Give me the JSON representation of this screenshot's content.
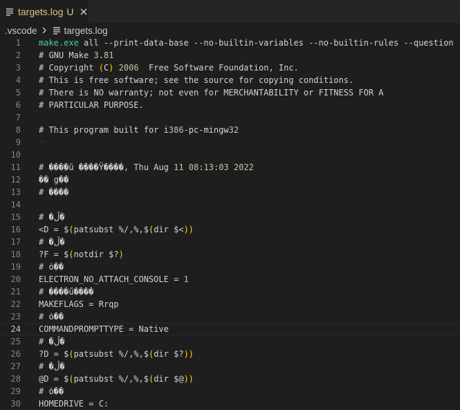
{
  "tab": {
    "file_name": "targets.log",
    "status": "U",
    "icon": "lines-file-icon",
    "close_icon": "close-icon"
  },
  "breadcrumb": {
    "folder": ".vscode",
    "file": "targets.log"
  },
  "editor": {
    "current_line": 24,
    "lines": [
      {
        "n": "1",
        "text": "make.exe all --print-data-base --no-builtin-variables --no-builtin-rules --question"
      },
      {
        "n": "2",
        "text": "# GNU Make 3.81"
      },
      {
        "n": "3",
        "text": "# Copyright (C) 2006  Free Software Foundation, Inc."
      },
      {
        "n": "4",
        "text": "# This is free software; see the source for copying conditions."
      },
      {
        "n": "5",
        "text": "# There is NO warranty; not even for MERCHANTABILITY or FITNESS FOR A"
      },
      {
        "n": "6",
        "text": "# PARTICULAR PURPOSE."
      },
      {
        "n": "7",
        "text": ""
      },
      {
        "n": "8",
        "text": "# This program built for i386-pc-mingw32"
      },
      {
        "n": "9",
        "text": ""
      },
      {
        "n": "10",
        "text": ""
      },
      {
        "n": "11",
        "text": "# ����ũ ����Ÿ����, Thu Aug 11 08:13:03 2022"
      },
      {
        "n": "12",
        "text": "�� g��"
      },
      {
        "n": "13",
        "text": "# ����"
      },
      {
        "n": "14",
        "text": ""
      },
      {
        "n": "15",
        "text": "# �ڵ�"
      },
      {
        "n": "16",
        "text": "<D = $(patsubst %/,%,$(dir $<))"
      },
      {
        "n": "17",
        "text": "# �ڵ�"
      },
      {
        "n": "18",
        "text": "?F = $(notdir $?)"
      },
      {
        "n": "19",
        "text": "# ȯ��"
      },
      {
        "n": "20",
        "text": "ELECTRON_NO_ATTACH_CONSOLE = 1"
      },
      {
        "n": "21",
        "text": "# ����ű����"
      },
      {
        "n": "22",
        "text": "MAKEFLAGS = Rrqp"
      },
      {
        "n": "23",
        "text": "# ȯ��"
      },
      {
        "n": "24",
        "text": "COMMANDPROMPTTYPE = Native"
      },
      {
        "n": "25",
        "text": "# �ڵ�"
      },
      {
        "n": "26",
        "text": "?D = $(patsubst %/,%,$(dir $?))"
      },
      {
        "n": "27",
        "text": "# �ڵ�"
      },
      {
        "n": "28",
        "text": "@D = $(patsubst %/,%,$(dir $@))"
      },
      {
        "n": "29",
        "text": "# ȯ��"
      },
      {
        "n": "30",
        "text": "HOMEDRIVE = C:"
      }
    ]
  },
  "colors": {
    "background": "#1e1e1e",
    "modified_file": "#e2c08d",
    "line_number": "#858585",
    "command": "#4ec9b0",
    "number": "#b5cea8",
    "paren": "#ffd700"
  }
}
